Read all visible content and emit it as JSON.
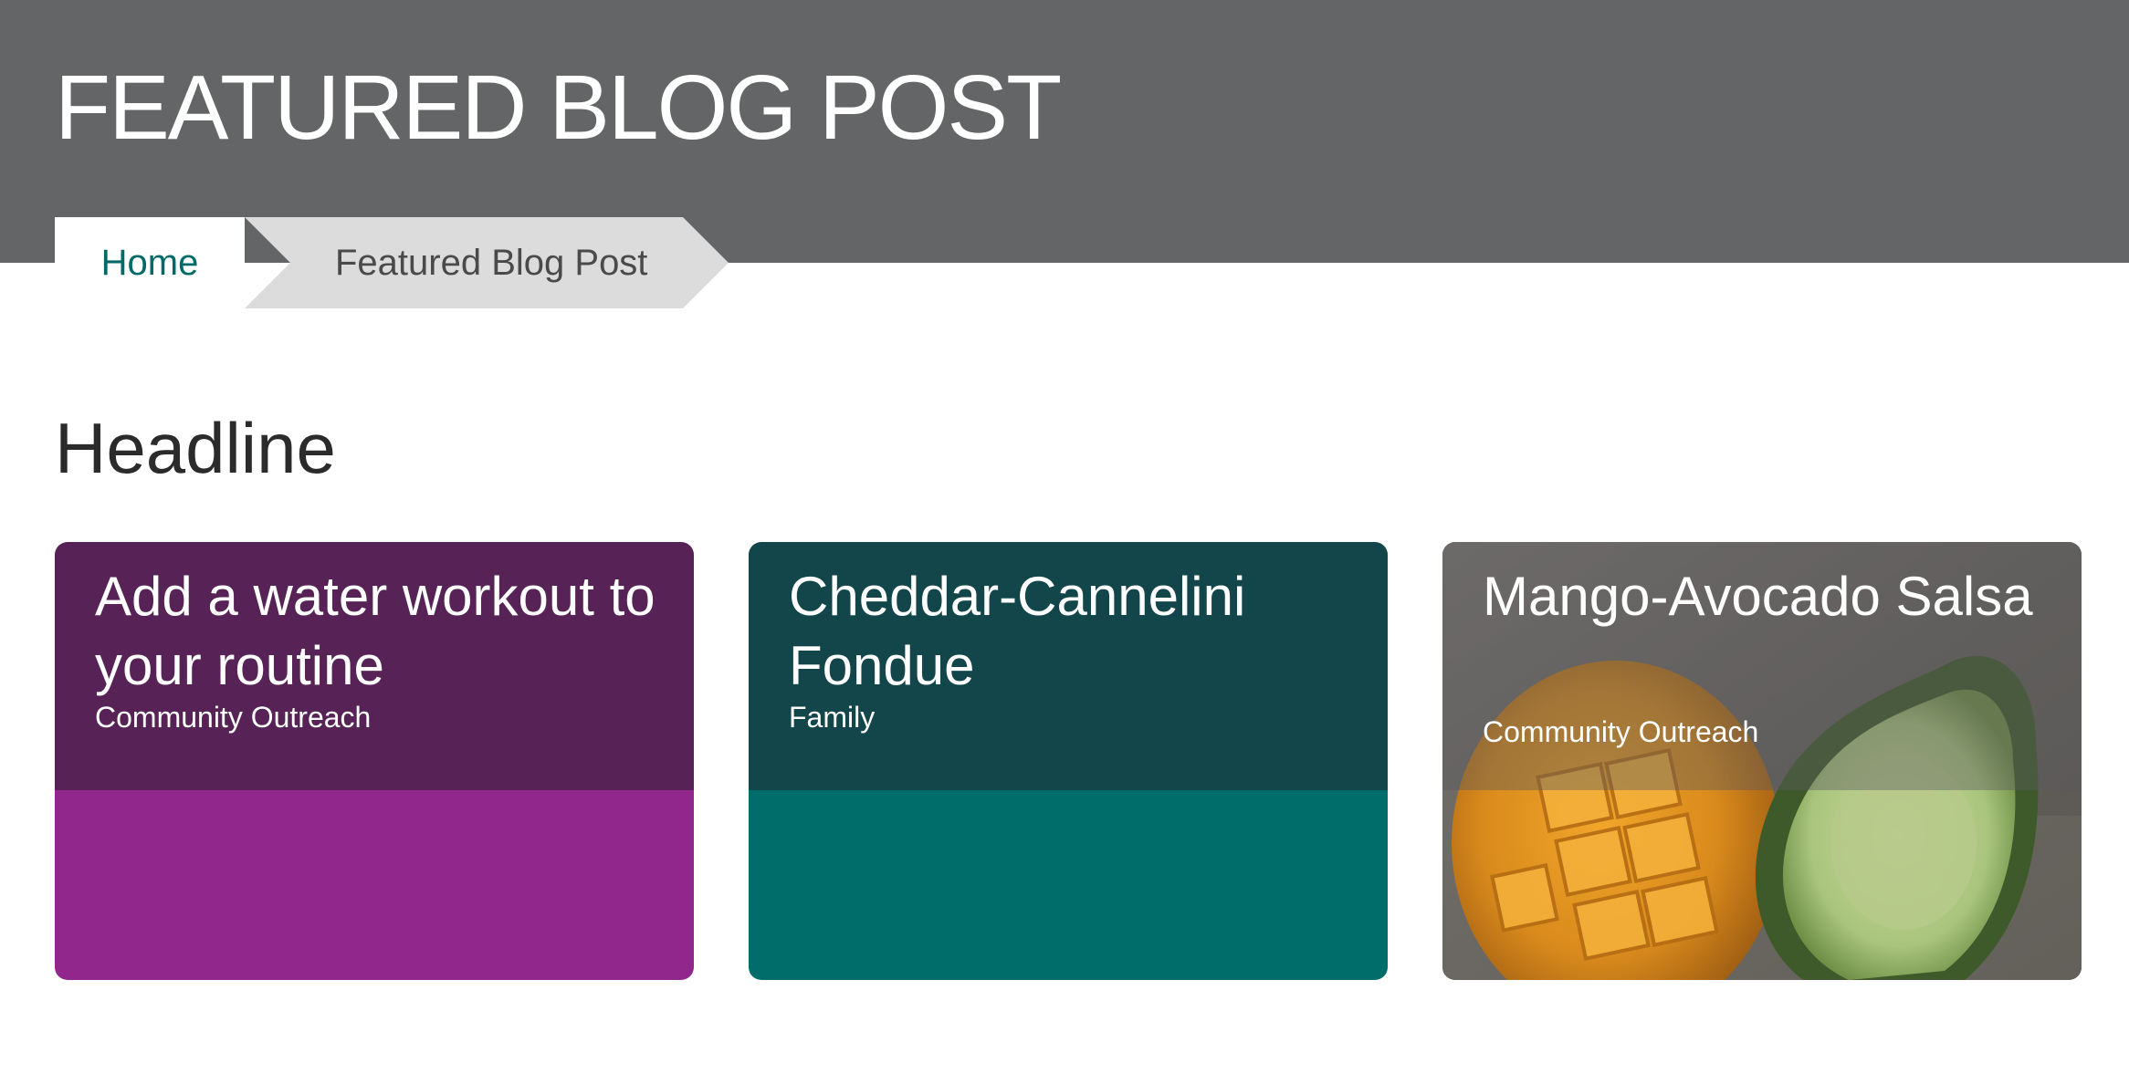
{
  "header": {
    "title": "FEATURED BLOG POST",
    "background_color": "#646567"
  },
  "breadcrumb": {
    "home_label": "Home",
    "current_label": "Featured Blog Post",
    "link_color": "#006a68"
  },
  "section": {
    "heading": "Headline"
  },
  "cards": [
    {
      "title": "Add a water workout to your routine",
      "category": "Community Outreach",
      "top_color": "#572255",
      "bottom_color": "#91278d"
    },
    {
      "title": "Cheddar-Cannelini Fondue",
      "category": "Family",
      "top_color": "#12464a",
      "bottom_color": "#006d6b"
    },
    {
      "title": "Mango-Avocado Salsa",
      "category": "Community Outreach",
      "image": "mango-avocado-photo"
    }
  ]
}
